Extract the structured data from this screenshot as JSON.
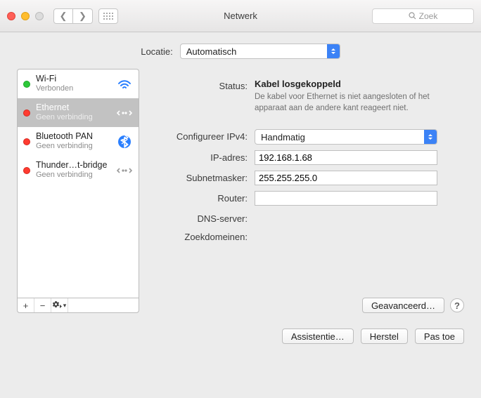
{
  "window": {
    "title": "Netwerk"
  },
  "search": {
    "placeholder": "Zoek"
  },
  "location": {
    "label": "Locatie:",
    "value": "Automatisch"
  },
  "sidebar": {
    "items": [
      {
        "name": "Wi-Fi",
        "sub": "Verbonden",
        "status": "green",
        "icon": "wifi"
      },
      {
        "name": "Ethernet",
        "sub": "Geen verbinding",
        "status": "red",
        "icon": "ethernet",
        "selected": true
      },
      {
        "name": "Bluetooth PAN",
        "sub": "Geen verbinding",
        "status": "red",
        "icon": "bluetooth"
      },
      {
        "name": "Thunder…t-bridge",
        "sub": "Geen verbinding",
        "status": "red",
        "icon": "ethernet-gray"
      }
    ],
    "footer": {
      "add": "+",
      "remove": "−",
      "gear": "gear"
    }
  },
  "detail": {
    "status_label": "Status:",
    "status_title": "Kabel losgekoppeld",
    "status_desc": "De kabel voor Ethernet is niet aangesloten of het apparaat aan de andere kant reageert niet.",
    "config_label": "Configureer IPv4:",
    "config_value": "Handmatig",
    "ip_label": "IP-adres:",
    "ip_value": "192.168.1.68",
    "subnet_label": "Subnetmasker:",
    "subnet_value": "255.255.255.0",
    "router_label": "Router:",
    "router_value": "",
    "dns_label": "DNS-server:",
    "domains_label": "Zoekdomeinen:",
    "advanced": "Geavanceerd…"
  },
  "actions": {
    "assist": "Assistentie…",
    "revert": "Herstel",
    "apply": "Pas toe"
  }
}
